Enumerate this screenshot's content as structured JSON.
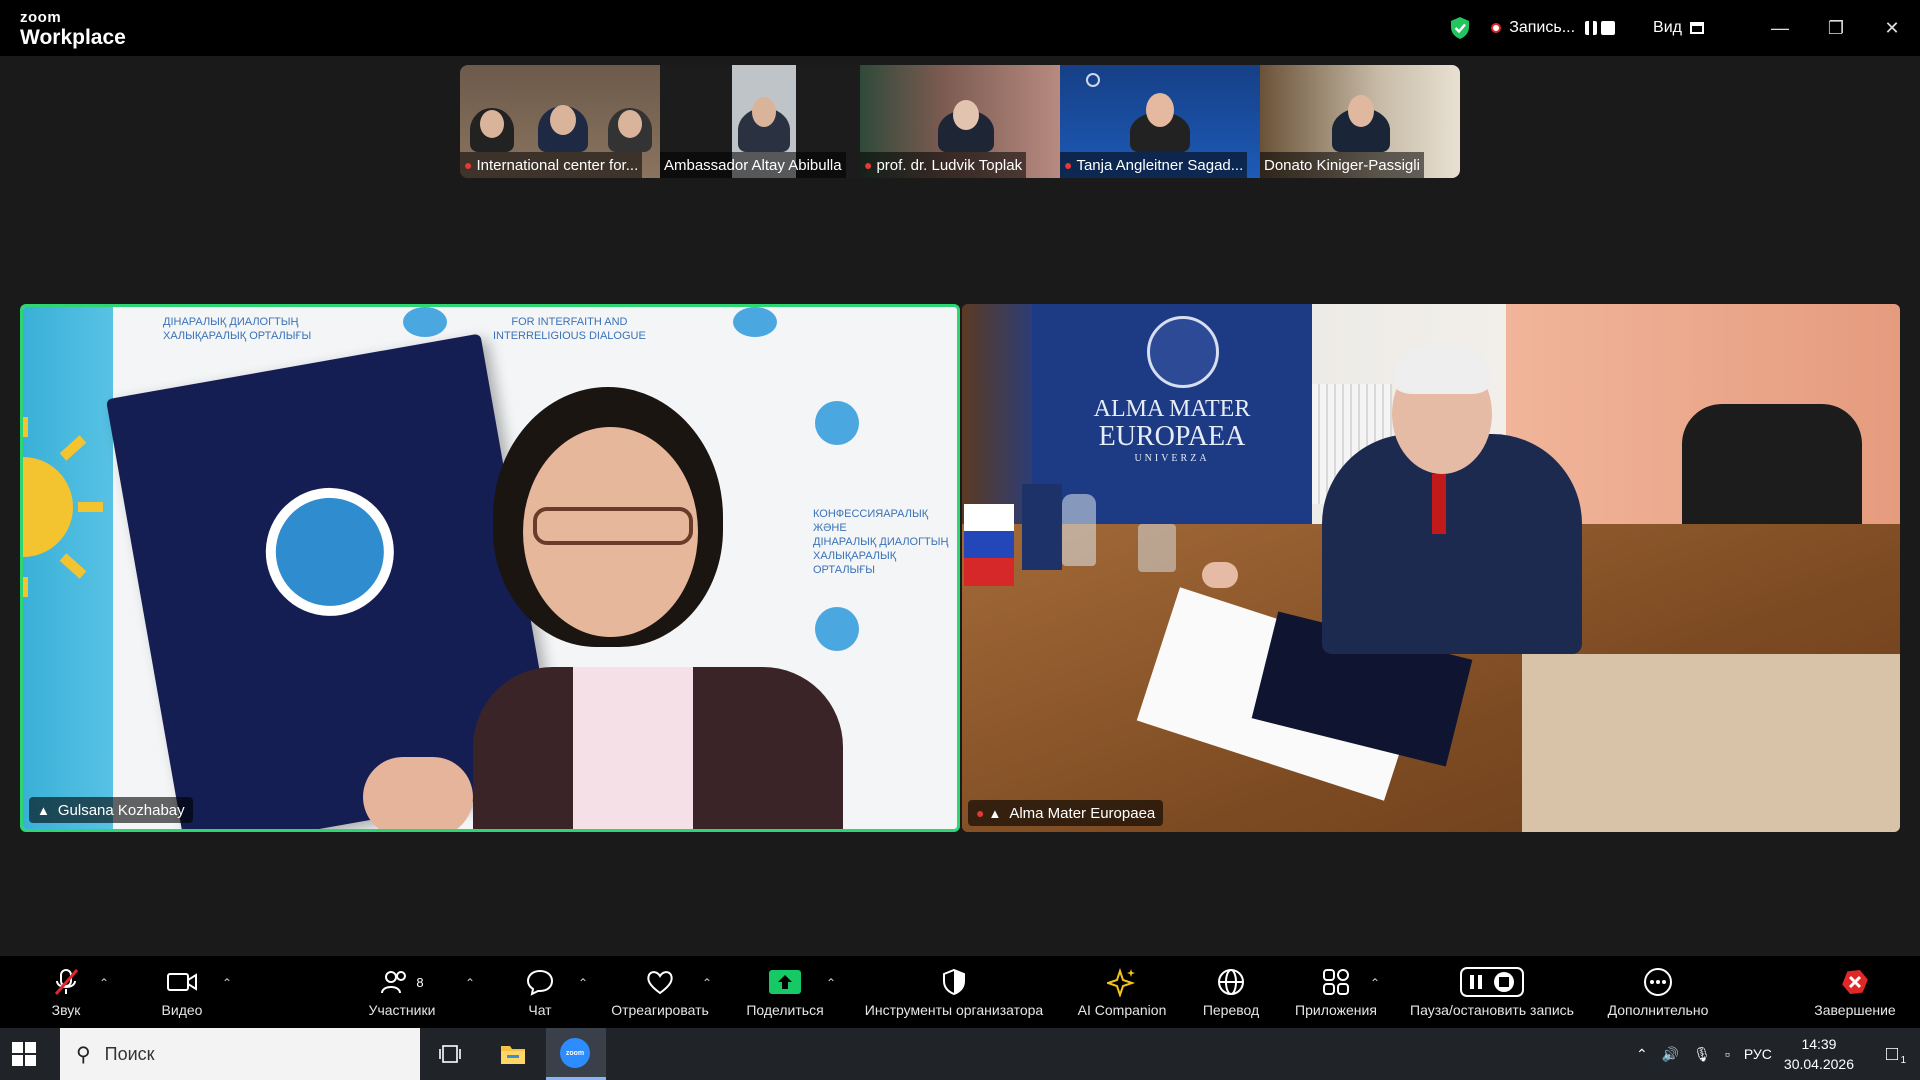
{
  "app": {
    "brand_top": "zoom",
    "brand_name": "Workplace"
  },
  "titlebar": {
    "recording_label": "Запись...",
    "view_label": "Вид"
  },
  "thumbnails": [
    {
      "name": "International center for...",
      "muted": true
    },
    {
      "name": "Ambassador Altay Abibulla",
      "muted": false
    },
    {
      "name": "prof. dr. Ludvik Toplak",
      "muted": true
    },
    {
      "name": "Tanja Angleitner Sagad...",
      "muted": true
    },
    {
      "name": "Donato Kiniger-Passigli",
      "muted": false
    }
  ],
  "tiles": {
    "left": {
      "name": "Gulsana Kozhabay",
      "background_text": [
        "ДІНАРАЛЫҚ ДИАЛОГТЫҢ",
        "ХАЛЫҚАРАЛЫҚ ОРТАЛЫҒЫ",
        "FOR INTERFAITH AND",
        "INTERRELIGIOUS DIALOGUE",
        "КОНФЕССИЯАРАЛЫҚ ЖӘНЕ",
        "ДІНАРАЛЫҚ ДИАЛОГТЫҢ",
        "ХАЛЫҚАРАЛЫҚ ОРТАЛЫҒЫ"
      ]
    },
    "right": {
      "name": "Alma Mater Europaea",
      "banner_line1": "ALMA MATER",
      "banner_line2": "EUROPAEA",
      "banner_line3": "UNIVERZA"
    }
  },
  "toolbar": {
    "audio": "Звук",
    "video": "Видео",
    "participants": "Участники",
    "participants_count": "8",
    "chat": "Чат",
    "react": "Отреагировать",
    "share": "Поделиться",
    "host_tools": "Инструменты организатора",
    "ai": "AI Companion",
    "translate": "Перевод",
    "apps": "Приложения",
    "record": "Пауза/остановить запись",
    "more": "Дополнительно",
    "end": "Завершение"
  },
  "taskbar": {
    "search_placeholder": "Поиск",
    "lang": "РУС",
    "time": "14:39",
    "date": "30.04.2026",
    "notif_count": "1"
  },
  "colors": {
    "active_speaker": "#2ed573",
    "share_green": "#17c964",
    "end_red": "#e02828",
    "ai_yellow": "#f5c518"
  }
}
